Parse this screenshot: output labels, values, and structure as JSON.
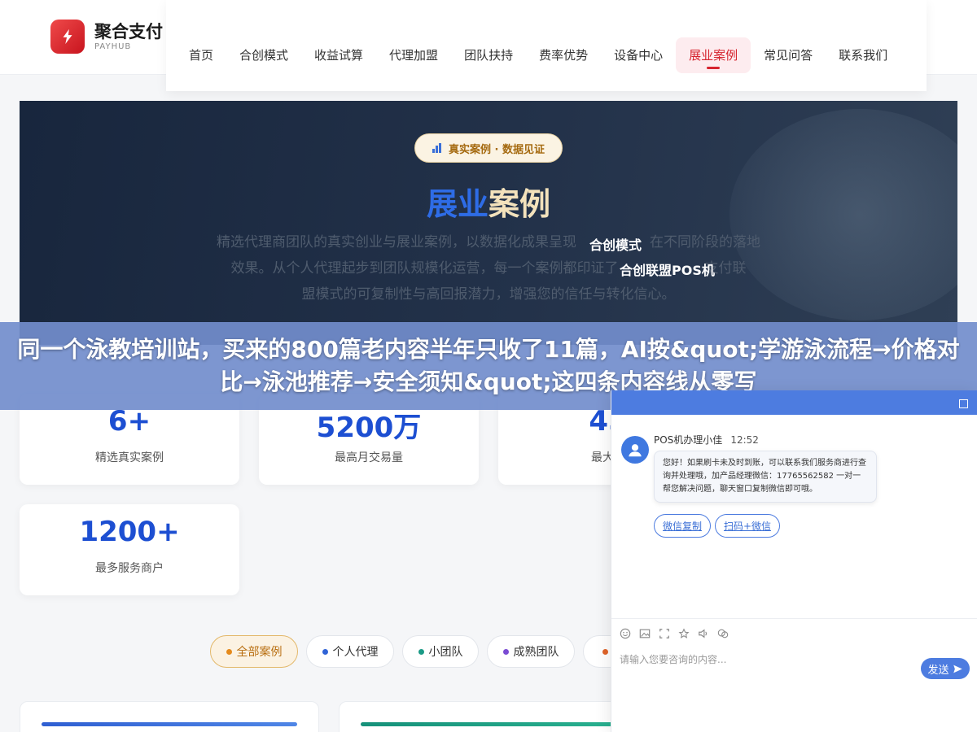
{
  "brand": {
    "name": "聚合支付",
    "sub": "PAYHUB",
    "accent": "#d6242e",
    "logo_icon": "lightning-icon"
  },
  "nav": {
    "items": [
      {
        "label": "首页"
      },
      {
        "label": "合创模式"
      },
      {
        "label": "收益试算"
      },
      {
        "label": "代理加盟"
      },
      {
        "label": "团队扶持"
      },
      {
        "label": "费率优势"
      },
      {
        "label": "设备中心"
      },
      {
        "label": "展业案例"
      },
      {
        "label": "常见问答"
      },
      {
        "label": "联系我们"
      }
    ],
    "active": "展业案例"
  },
  "hero": {
    "pill": "真实案例 · 数据见证",
    "pill_icon": "bar-chart-icon",
    "title_part1": "展业",
    "title_part2": "案例",
    "desc_lines": [
      "精选代理商团队的真实创业与展业案例，以数据化成果呈现",
      "在不同阶段的落地",
      "效果。从个人代理起步到团队规模化运营，每一个案例都印证了",
      "支付联",
      "盟模式的可复制性与高回报潜力，增强您的信任与转化信心。"
    ],
    "float_1": "合创模式",
    "float_2": "合创联盟POS机"
  },
  "banner": {
    "text": "同一个泳教培训站，买来的800篇老内容半年只收了11篇，AI按&quot;学游泳流程→价格对比→泳池推荐→安全须知&quot;这四条内容线从零写"
  },
  "stats": [
    {
      "value": "6+",
      "label": "精选真实案例"
    },
    {
      "value": "5200万",
      "label": "最高月交易量"
    },
    {
      "value": "45",
      "label": "最大团"
    },
    {
      "value": "1200+",
      "label": "最多服务商户"
    }
  ],
  "filters": [
    {
      "label": "全部案例",
      "color": "#e58a1c"
    },
    {
      "label": "个人代理",
      "color": "#2f63d6"
    },
    {
      "label": "小团队",
      "color": "#1a9a86"
    },
    {
      "label": "成熟团队",
      "color": "#7a4bd3"
    },
    {
      "label": "",
      "color": "#e0642a"
    }
  ],
  "cases": {
    "bar_colors": [
      "#3a6fd8",
      "#1d9a7e"
    ]
  },
  "chat": {
    "agent_name": "POS机办理小佳",
    "time": "12:52",
    "message": "您好！如果刷卡未及时到账，可以联系我们服务商进行查询并处理哦，加产品经理微信：17765562582 一对一帮您解决问题，聊天窗口复制微信即可哦。",
    "btn_copy": "微信复制",
    "btn_scan": "扫码+微信",
    "input_placeholder": "请输入您要咨询的内容...",
    "send_label": "发送",
    "header_color": "#4d7ce0"
  }
}
